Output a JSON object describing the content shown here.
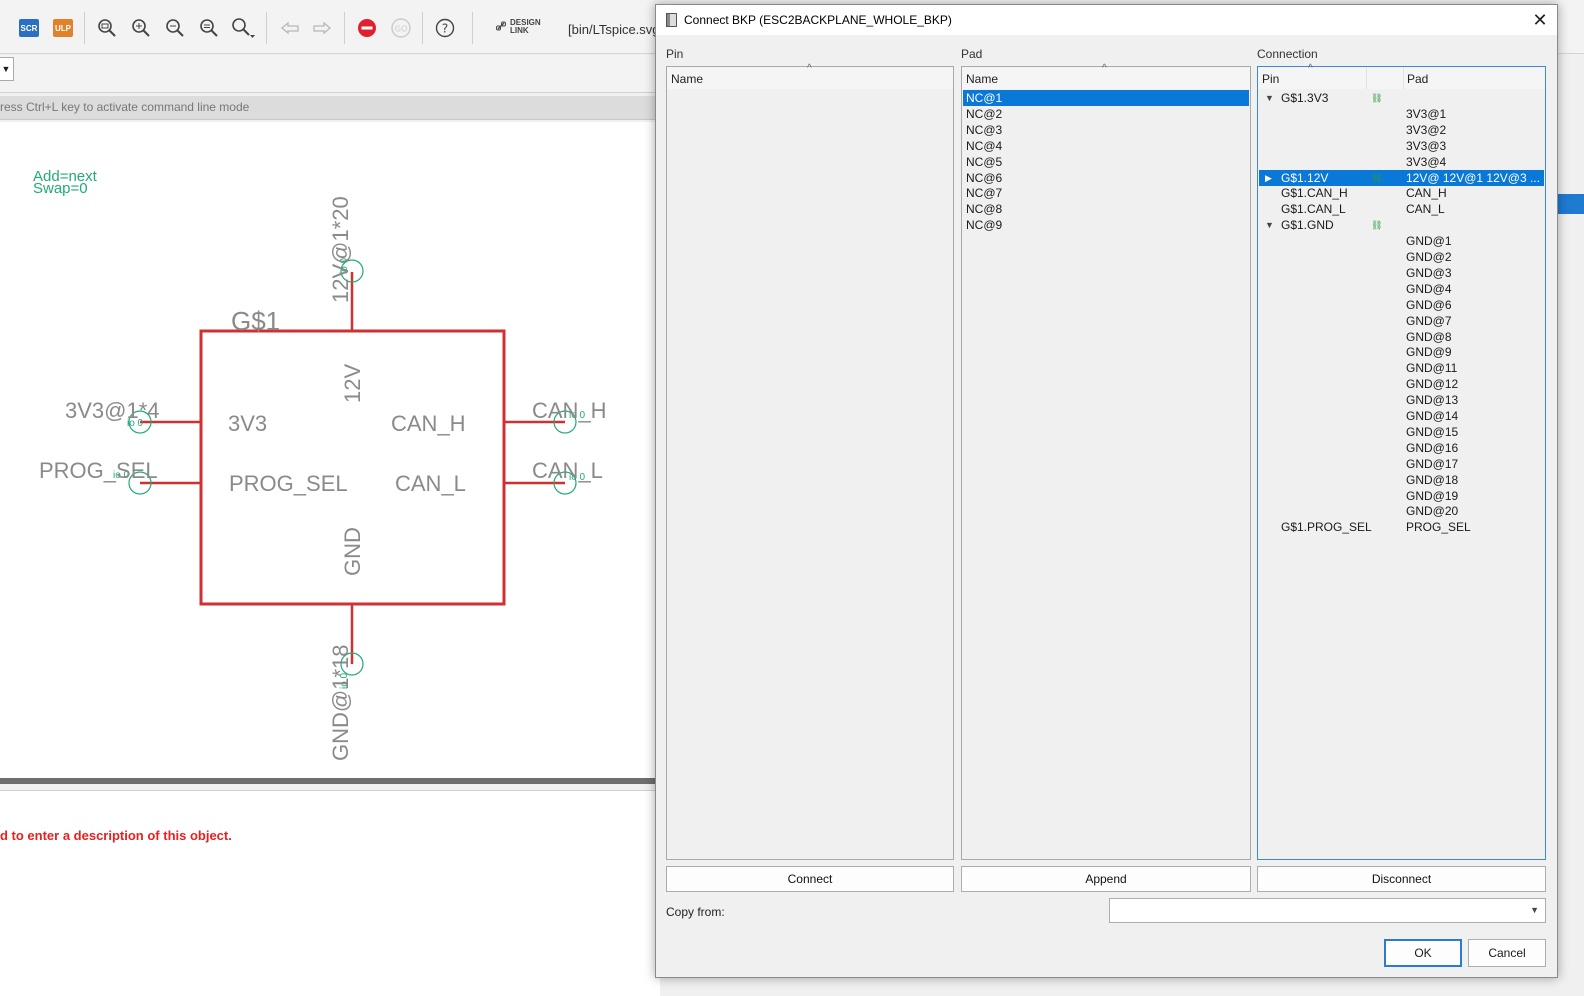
{
  "toolbar": {
    "scr_label": "SCR",
    "ulp_label": "ULP",
    "design_link_line1": "DESIGN",
    "design_link_line2": "LINK",
    "path_text": "[bin/LTspice.svg]",
    "icons": [
      "script-icon",
      "ulp-icon",
      "zoom-fit-icon",
      "zoom-in-icon",
      "zoom-out-icon",
      "zoom-select-icon",
      "zoom-window-icon",
      "undo-icon",
      "redo-icon",
      "stop-icon",
      "go-icon",
      "help-icon",
      "link-icon"
    ],
    "colors": {
      "scr": "#2a6fc2",
      "ulp": "#e0822a",
      "stop": "#e02030"
    }
  },
  "layer_select": {
    "arrow": "▼"
  },
  "command_bar": {
    "hint": "ress Ctrl+L key to activate command line mode"
  },
  "schematic": {
    "param_add": "Add=next",
    "param_swap": "Swap=0",
    "symbol_name": "G$1",
    "pin_12v": "12V",
    "pin_3v3": "3V3",
    "pin_can_h": "CAN_H",
    "pin_can_l": "CAN_L",
    "pin_prog_sel": "PROG_SEL",
    "pin_gnd": "GND",
    "pad_12v": "12V@1*20",
    "pad_3v3": "3V3@1*4",
    "pad_can_h": "CAN_H",
    "pad_can_l": "CAN_L",
    "pad_prog_sel": "PROG_SEL",
    "pad_gnd": "GND@1*18",
    "pin_tag": "io 0",
    "colors": {
      "symbol": "#d03030",
      "text": "#8a8a8a",
      "accent": "#22aa77"
    }
  },
  "description": {
    "text": "d to enter a description of this object."
  },
  "dialog": {
    "title": "Connect BKP (ESC2BACKPLANE_WHOLE_BKP)",
    "close_label": "✕",
    "pin_group": {
      "label": "Pin",
      "header": "Name",
      "sort": "^"
    },
    "pad_group": {
      "label": "Pad",
      "header": "Name",
      "sort": "^",
      "items": [
        "NC@1",
        "NC@2",
        "NC@3",
        "NC@4",
        "NC@5",
        "NC@6",
        "NC@7",
        "NC@8",
        "NC@9"
      ],
      "selected_index": 0
    },
    "connection_group": {
      "label": "Connection",
      "header_pin": "Pin",
      "header_pad": "Pad",
      "sort": "^",
      "rows": [
        {
          "expander": "▼",
          "pin": "G$1.3V3",
          "link": "⛓",
          "pad": ""
        },
        {
          "expander": "",
          "pin": "",
          "link": "",
          "pad": "3V3@1"
        },
        {
          "expander": "",
          "pin": "",
          "link": "",
          "pad": "3V3@2"
        },
        {
          "expander": "",
          "pin": "",
          "link": "",
          "pad": "3V3@3"
        },
        {
          "expander": "",
          "pin": "",
          "link": "",
          "pad": "3V3@4"
        },
        {
          "expander": "▶",
          "pin": "G$1.12V",
          "link": "⛓",
          "pad": "12V@ 12V@1 12V@3 ..."
        },
        {
          "expander": "",
          "pin": "G$1.CAN_H",
          "link": "",
          "pad": "CAN_H"
        },
        {
          "expander": "",
          "pin": "G$1.CAN_L",
          "link": "",
          "pad": "CAN_L"
        },
        {
          "expander": "▼",
          "pin": "G$1.GND",
          "link": "⛓",
          "pad": ""
        },
        {
          "expander": "",
          "pin": "",
          "link": "",
          "pad": "GND@1"
        },
        {
          "expander": "",
          "pin": "",
          "link": "",
          "pad": "GND@2"
        },
        {
          "expander": "",
          "pin": "",
          "link": "",
          "pad": "GND@3"
        },
        {
          "expander": "",
          "pin": "",
          "link": "",
          "pad": "GND@4"
        },
        {
          "expander": "",
          "pin": "",
          "link": "",
          "pad": "GND@6"
        },
        {
          "expander": "",
          "pin": "",
          "link": "",
          "pad": "GND@7"
        },
        {
          "expander": "",
          "pin": "",
          "link": "",
          "pad": "GND@8"
        },
        {
          "expander": "",
          "pin": "",
          "link": "",
          "pad": "GND@9"
        },
        {
          "expander": "",
          "pin": "",
          "link": "",
          "pad": "GND@11"
        },
        {
          "expander": "",
          "pin": "",
          "link": "",
          "pad": "GND@12"
        },
        {
          "expander": "",
          "pin": "",
          "link": "",
          "pad": "GND@13"
        },
        {
          "expander": "",
          "pin": "",
          "link": "",
          "pad": "GND@14"
        },
        {
          "expander": "",
          "pin": "",
          "link": "",
          "pad": "GND@15"
        },
        {
          "expander": "",
          "pin": "",
          "link": "",
          "pad": "GND@16"
        },
        {
          "expander": "",
          "pin": "",
          "link": "",
          "pad": "GND@17"
        },
        {
          "expander": "",
          "pin": "",
          "link": "",
          "pad": "GND@18"
        },
        {
          "expander": "",
          "pin": "",
          "link": "",
          "pad": "GND@19"
        },
        {
          "expander": "",
          "pin": "",
          "link": "",
          "pad": "GND@20"
        },
        {
          "expander": "",
          "pin": "G$1.PROG_SEL",
          "link": "",
          "pad": "PROG_SEL"
        }
      ],
      "selected_index": 5
    },
    "buttons": {
      "connect": "Connect",
      "append": "Append",
      "disconnect": "Disconnect",
      "ok": "OK",
      "cancel": "Cancel"
    },
    "copy_from": {
      "label": "Copy from:",
      "value": "",
      "arrow": "▼"
    },
    "colors": {
      "selection": "#0a78d7",
      "focus_border": "#3b8ad8",
      "link_icon": "#2a9a3a"
    }
  }
}
